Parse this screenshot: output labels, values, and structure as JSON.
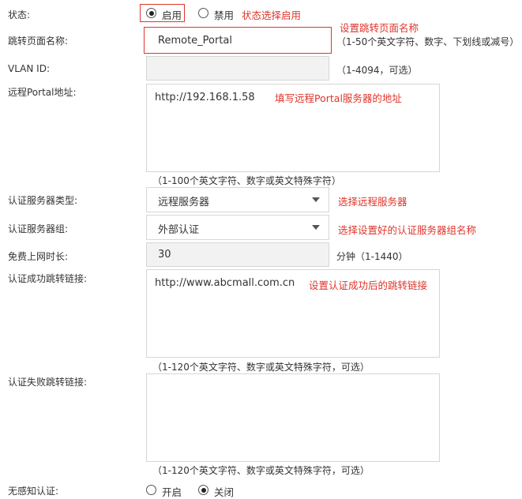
{
  "status": {
    "label": "状态:",
    "options": [
      {
        "label": "启用",
        "selected": true
      },
      {
        "label": "禁用",
        "selected": false
      }
    ],
    "annotation": "状态选择启用"
  },
  "page_name": {
    "label": "跳转页面名称:",
    "value": "Remote_Portal",
    "annotation": "设置跳转页面名称",
    "hint": "（1-50个英文字符、数字、下划线或减号）"
  },
  "vlan": {
    "label": "VLAN ID:",
    "value": "",
    "hint": "（1-4094，可选）"
  },
  "portal_address": {
    "label": "远程Portal地址:",
    "value": "http://192.168.1.58",
    "annotation": "填写远程Portal服务器的地址",
    "hint": "（1-100个英文字符、数字或英文特殊字符）"
  },
  "auth_server_type": {
    "label": "认证服务器类型:",
    "value": "远程服务器",
    "annotation": "选择远程服务器"
  },
  "auth_server_group": {
    "label": "认证服务器组:",
    "value": "外部认证",
    "annotation": "选择设置好的认证服务器组名称"
  },
  "free_time": {
    "label": "免费上网时长:",
    "value": "30",
    "hint": "分钟（1-1440）"
  },
  "success_link": {
    "label": "认证成功跳转链接:",
    "value": "http://www.abcmall.com.cn",
    "annotation": "设置认证成功后的跳转链接",
    "hint": "（1-120个英文字符、数字或英文特殊字符，可选）"
  },
  "failure_link": {
    "label": "认证失败跳转链接:",
    "value": "",
    "hint": "（1-120个英文字符、数字或英文特殊字符，可选）"
  },
  "seamless_auth": {
    "label": "无感知认证:",
    "options": [
      {
        "label": "开启",
        "selected": false
      },
      {
        "label": "关闭",
        "selected": true
      }
    ]
  },
  "colors": {
    "annotation_red": "#e0352b",
    "field_border": "#d6d6d6",
    "disabled_bg": "#f2f2f2"
  }
}
